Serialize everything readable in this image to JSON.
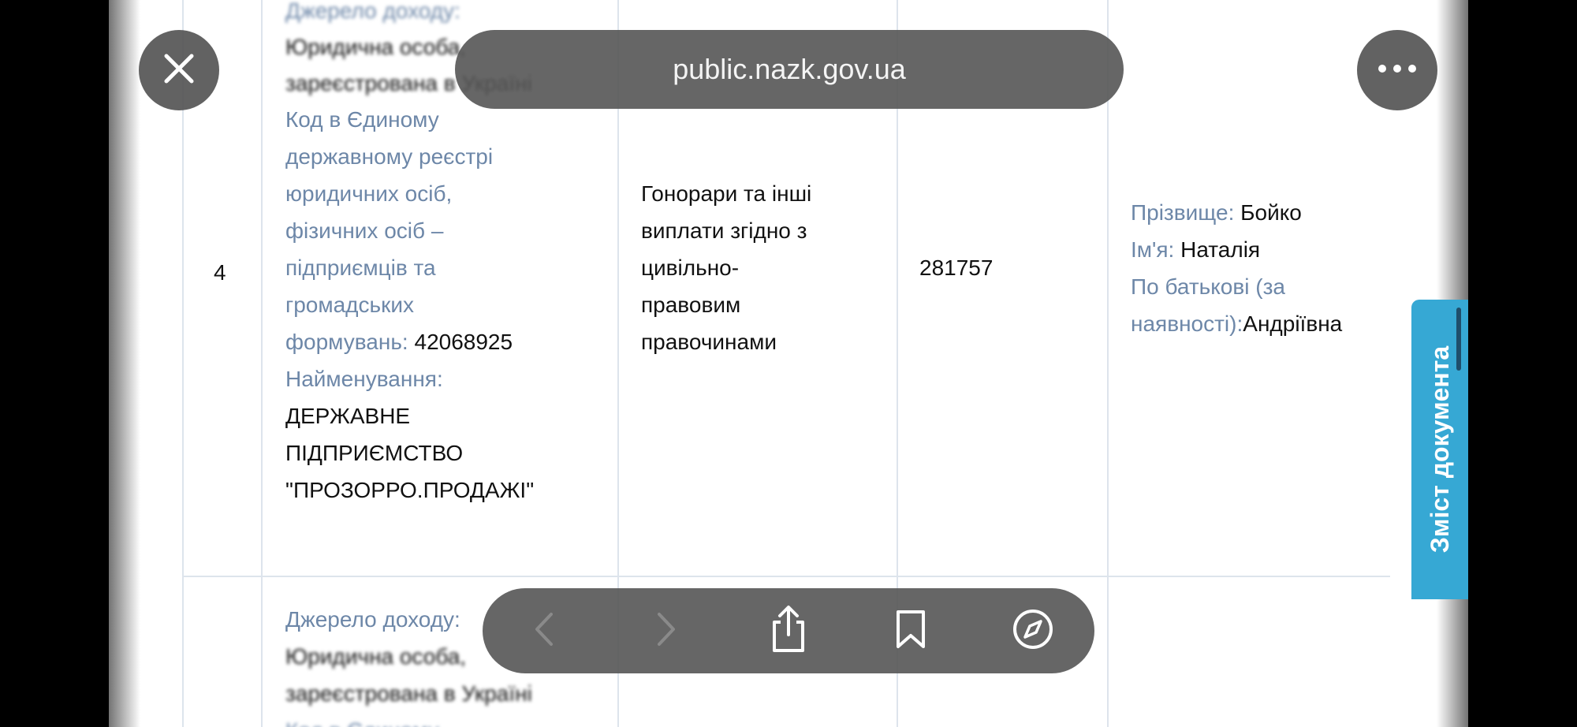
{
  "browser": {
    "url": "public.nazk.gov.ua"
  },
  "row_prev": {
    "source_label": "Джерело доходу:",
    "entity_type": "Юридична особа,",
    "registered_line": "зареєстрована в Україні"
  },
  "row": {
    "number": "4",
    "code_label_lines": [
      "Код в Єдиному",
      "державному реєстрі",
      "юридичних осіб,",
      "фізичних осіб –",
      "підприємців та",
      "громадських"
    ],
    "code_label_last": "формувань:",
    "code_value": "42068925",
    "name_label": "Найменування:",
    "name_lines": [
      "ДЕРЖАВНЕ",
      "ПІДПРИЄМСТВО",
      "\"ПРОЗОРРО.ПРОДАЖІ\""
    ],
    "income_type_lines": [
      "Гонорари та інші",
      "виплати згідно з",
      "цивільно-",
      "правовим",
      "правочинами"
    ],
    "amount": "281757",
    "surname_label": "Прізвище:",
    "surname": "Бойко",
    "name_first_label": "Ім'я:",
    "name_first": "Наталія",
    "patronymic_label_line1": "По батькові (за",
    "patronymic_label_line2": "наявності):",
    "patronymic": "Андріївна"
  },
  "row_next": {
    "source_label": "Джерело доходу:",
    "entity_type": "Юридична особа,",
    "registered_line": "зареєстрована в Україні",
    "code_partial": "Код в Єдиному"
  },
  "side_tab": {
    "label": "Зміст документа"
  },
  "icons": {
    "close": "close-icon",
    "more": "more-icon",
    "back": "chevron-left-icon",
    "forward": "chevron-right-icon",
    "share": "share-icon",
    "bookmark": "bookmark-icon",
    "compass": "compass-icon"
  }
}
